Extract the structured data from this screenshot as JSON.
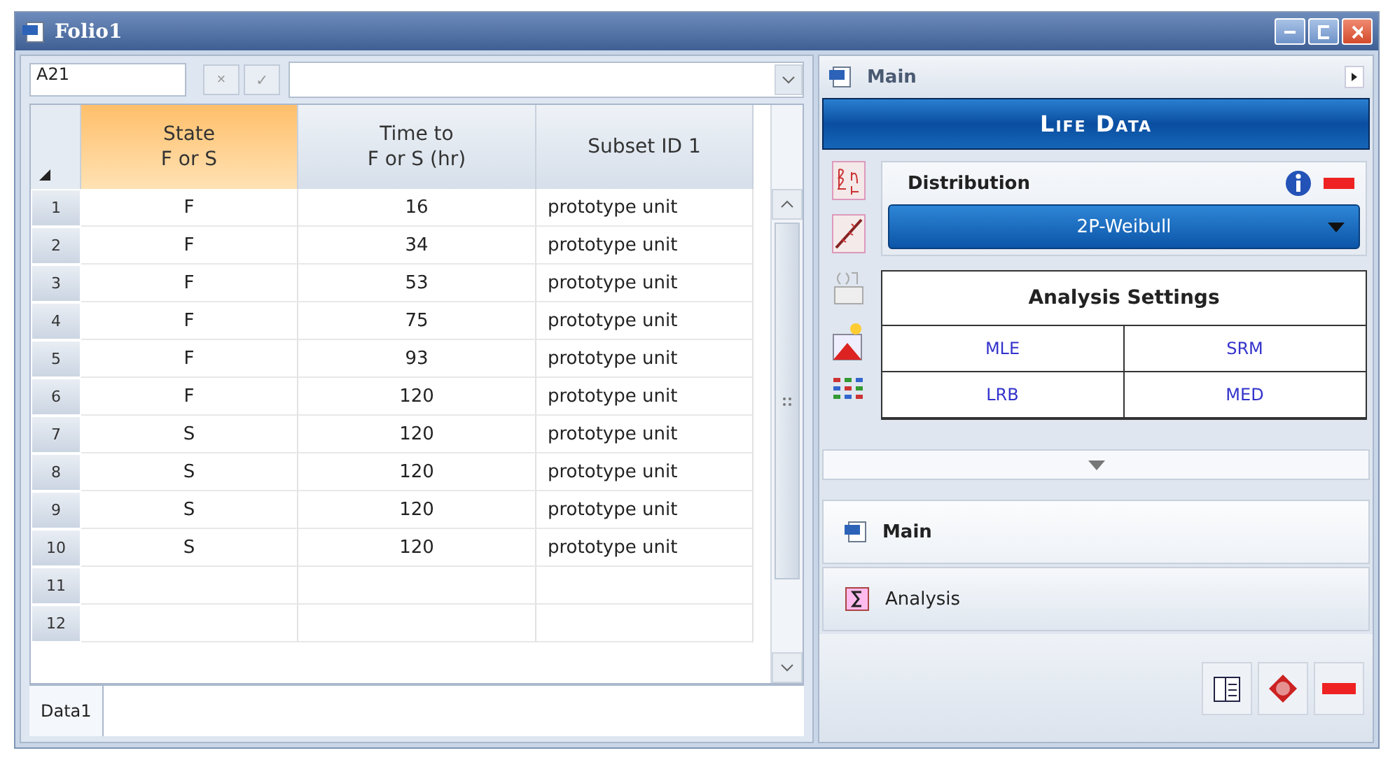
{
  "window": {
    "title": "Folio1"
  },
  "formula_bar": {
    "cell_ref": "A21",
    "cancel": "×",
    "confirm": "✓"
  },
  "table": {
    "columns": [
      {
        "label": "State\nF or S",
        "selected": true
      },
      {
        "label": "Time to\nF or S (hr)",
        "selected": false
      },
      {
        "label": "Subset ID 1",
        "selected": false
      }
    ],
    "rows": [
      {
        "number": "1",
        "cells": [
          "F",
          "16",
          "prototype unit"
        ]
      },
      {
        "number": "2",
        "cells": [
          "F",
          "34",
          "prototype unit"
        ]
      },
      {
        "number": "3",
        "cells": [
          "F",
          "53",
          "prototype unit"
        ]
      },
      {
        "number": "4",
        "cells": [
          "F",
          "75",
          "prototype unit"
        ]
      },
      {
        "number": "5",
        "cells": [
          "F",
          "93",
          "prototype unit"
        ]
      },
      {
        "number": "6",
        "cells": [
          "F",
          "120",
          "prototype unit"
        ]
      },
      {
        "number": "7",
        "cells": [
          "S",
          "120",
          "prototype unit"
        ]
      },
      {
        "number": "8",
        "cells": [
          "S",
          "120",
          "prototype unit"
        ]
      },
      {
        "number": "9",
        "cells": [
          "S",
          "120",
          "prototype unit"
        ]
      },
      {
        "number": "10",
        "cells": [
          "S",
          "120",
          "prototype unit"
        ]
      },
      {
        "number": "11"
      },
      {
        "number": "12"
      }
    ]
  },
  "sheet_tabs": [
    {
      "label": "Data1",
      "selected": true
    }
  ],
  "panel": {
    "header": "Main",
    "banner": "Life Data",
    "distribution": {
      "title": "Distribution",
      "value": "2P-Weibull"
    },
    "analysis_settings": {
      "title": "Analysis Settings",
      "options": [
        "MLE",
        "SRM",
        "LRB",
        "MED"
      ]
    },
    "nav": [
      {
        "label": "Main",
        "selected": true,
        "kind": "doc"
      },
      {
        "label": "Analysis",
        "selected": false,
        "kind": "sigma"
      }
    ]
  }
}
